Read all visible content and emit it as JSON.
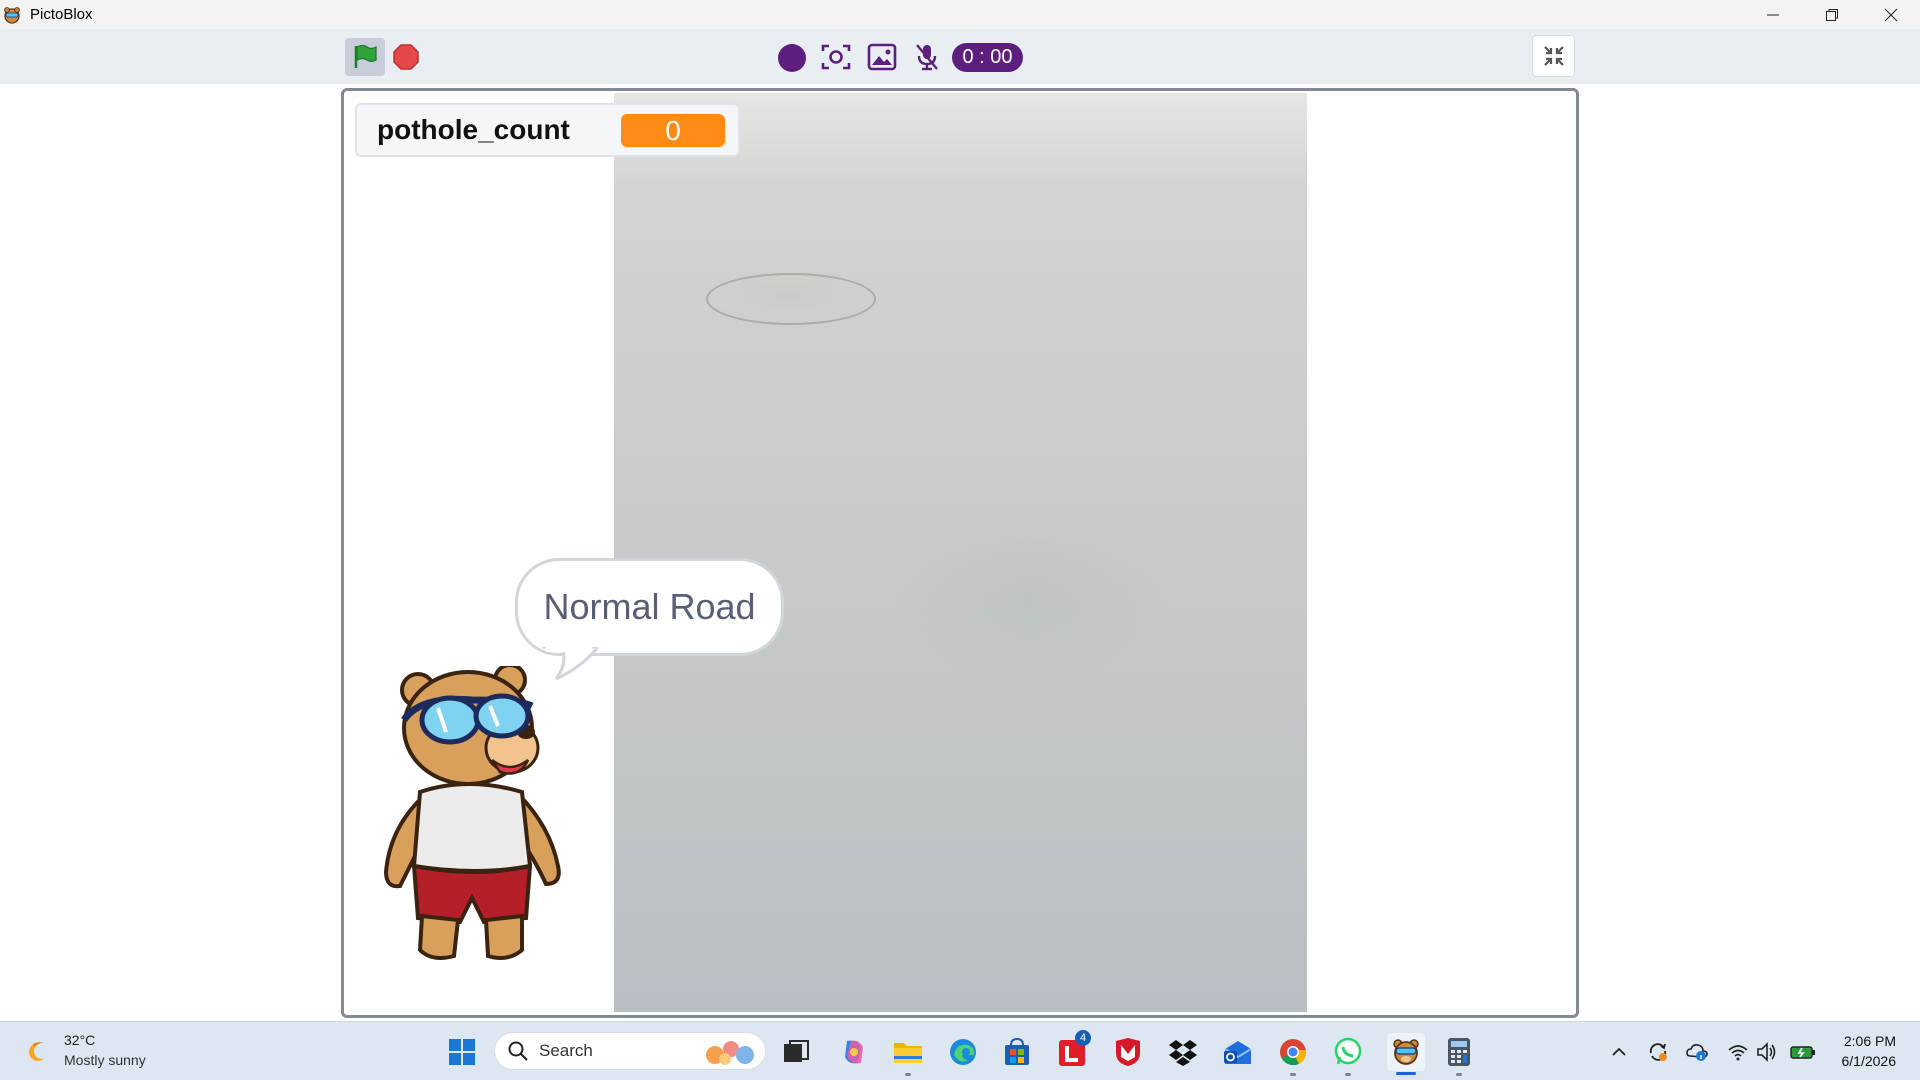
{
  "window": {
    "title": "PictoBlox"
  },
  "toolbar": {
    "timer": "0 : 00"
  },
  "stage": {
    "variable": {
      "name": "pothole_count",
      "value": "0"
    },
    "speech": "Normal Road"
  },
  "taskbar": {
    "weather": {
      "temp": "32°C",
      "desc": "Mostly sunny"
    },
    "search_placeholder": "Search",
    "badge_count": "4",
    "clock": {
      "time": "2:06 PM",
      "date": "6/1/2026"
    }
  },
  "colors": {
    "accent": "#5d1f7e",
    "variable": "#ff8a14",
    "flag": "#2ea43a",
    "stop": "#e6484a"
  }
}
